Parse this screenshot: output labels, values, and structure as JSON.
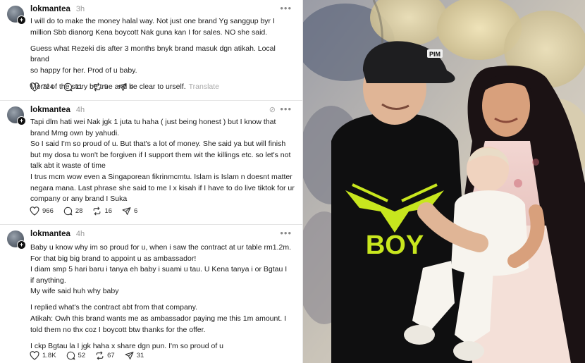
{
  "posts": [
    {
      "username": "lokmantea",
      "time": "3h",
      "lines": [
        "I will do to make the money halal way. Not just one brand Yg sanggup byr I",
        "million Sbb dianorg Kena boycott Nak guna kan I for sales. NO she said.",
        "",
        "Guess what Rezeki dis after 3 months bnyk brand masuk dgn atikah. Local brand",
        "so happy for her. Prod of u baby.",
        "",
        "Moral of the story be true and be clear to urself."
      ],
      "translate": "Translate",
      "likes": "724",
      "comments": "11",
      "reposts": "9",
      "shares": "4"
    },
    {
      "username": "lokmantea",
      "time": "4h",
      "lines": [
        "Tapi dlm hati wei Nak jgk 1 juta tu haha ( just being honest ) but I know that",
        "brand Mmg own by yahudi.",
        "So I said I'm so proud of u. But that's a lot of money. She said ya but will finish",
        "but my dosa tu won't be forgiven if I support them wit the killings etc. so let's not",
        "talk abt it waste of time",
        "I trus mcm wow even a Singaporean fikrinmcmtu. Islam is Islam n doesnt matter",
        "negara mana. Last phrase she said to me I x kisah if I have to do live tiktok for ur",
        "company or any brand I Suka"
      ],
      "likes": "966",
      "comments": "28",
      "reposts": "16",
      "shares": "6"
    },
    {
      "username": "lokmantea",
      "time": "4h",
      "lines": [
        "Baby u know why im so proud for u, when i saw the contract at ur table rm1.2m.",
        "For that big big brand to appoint u as ambassador!",
        "I diam smp 5 hari baru i tanya eh baby i suami u tau. U Kena tanya i or Bgtau I",
        "if anything.",
        "My wife said huh why baby",
        "",
        "I replied what's the contract abt from that company.",
        "Atikah: Owh this brand wants me as ambassador paying me this 1m amount. I",
        "told them no thx coz I boycott btw thanks for the offer.",
        "",
        "I ckp Bgtau la I jgk haha x share dgn pun. I'm so proud of u"
      ],
      "likes": "1.8K",
      "comments": "52",
      "reposts": "67",
      "shares": "31"
    }
  ],
  "photo": {
    "cap_text": "PIM",
    "shirt_text": "BOY"
  },
  "icons": {
    "like": "heart-icon",
    "comment": "comment-bubble-icon",
    "repost": "repost-icon",
    "share": "share-send-icon",
    "more": "more-dots-icon",
    "edit": "edited-icon",
    "follow": "follow-plus-icon"
  },
  "colors": {
    "text": "#111111",
    "muted": "#999999",
    "divider": "#e5e5e5",
    "shirt_print": "#c8e61e"
  }
}
